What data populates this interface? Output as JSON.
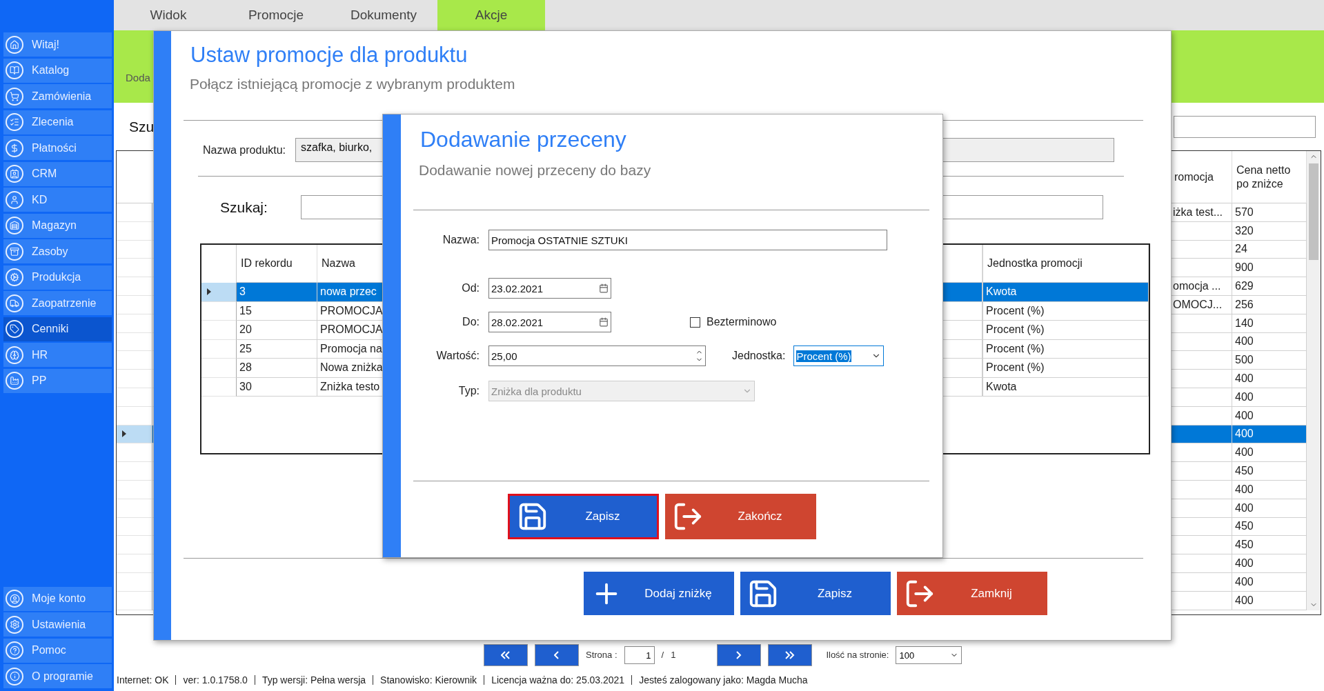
{
  "sidebar": {
    "items": [
      {
        "label": "Witaj!",
        "selected": false
      },
      {
        "label": "Katalog",
        "selected": false
      },
      {
        "label": "Zamówienia",
        "selected": false
      },
      {
        "label": "Zlecenia",
        "selected": false
      },
      {
        "label": "Płatności",
        "selected": false
      },
      {
        "label": "CRM",
        "selected": false
      },
      {
        "label": "KD",
        "selected": false
      },
      {
        "label": "Magazyn",
        "selected": false
      },
      {
        "label": "Zasoby",
        "selected": false
      },
      {
        "label": "Produkcja",
        "selected": false
      },
      {
        "label": "Zaopatrzenie",
        "selected": false
      },
      {
        "label": "Cenniki",
        "selected": true
      },
      {
        "label": "HR",
        "selected": false
      },
      {
        "label": "PP",
        "selected": false
      }
    ],
    "bottom_items": [
      {
        "label": "Moje konto"
      },
      {
        "label": "Ustawienia"
      },
      {
        "label": "Pomoc"
      },
      {
        "label": "O programie"
      }
    ]
  },
  "menu_tabs": [
    {
      "label": "Widok",
      "selected": false
    },
    {
      "label": "Promocje",
      "selected": false
    },
    {
      "label": "Dokumenty",
      "selected": false
    },
    {
      "label": "Akcje",
      "selected": true
    }
  ],
  "background": {
    "toolbar_label": "Doda",
    "search_label": "Szu",
    "table": {
      "columns": [
        "romocja",
        "Cena netto po zniżce"
      ],
      "rows": [
        {
          "column_1": "iżka test...",
          "price": "570",
          "selected": false
        },
        {
          "price": "320",
          "selected": false
        },
        {
          "price": "24",
          "selected": false
        },
        {
          "price": "900",
          "selected": false
        },
        {
          "column_1": "omocja ...",
          "price": "629",
          "selected": false
        },
        {
          "column_1": "OMOCJ...",
          "price": "256",
          "selected": false
        },
        {
          "price": "140",
          "selected": false
        },
        {
          "price": "400",
          "selected": false
        },
        {
          "price": "500",
          "selected": false
        },
        {
          "price": "400",
          "selected": false
        },
        {
          "price": "400",
          "selected": false
        },
        {
          "price": "400",
          "selected": false
        },
        {
          "price": "400",
          "selected": true
        },
        {
          "price": "400",
          "selected": false
        },
        {
          "price": "450",
          "selected": false
        },
        {
          "price": "400",
          "selected": false
        },
        {
          "price": "400",
          "selected": false
        },
        {
          "price": "450",
          "selected": false
        },
        {
          "price": "450",
          "selected": false
        },
        {
          "price": "400",
          "selected": false
        },
        {
          "price": "400",
          "selected": false
        },
        {
          "price": "400",
          "selected": false
        }
      ]
    },
    "pagination": {
      "page_label": "Strona :",
      "page": "1",
      "separator": "/",
      "total": "1",
      "per_page_label": "Ilość na stronie:",
      "per_page": "100"
    }
  },
  "promo_dialog": {
    "title": "Ustaw promocje dla produktu",
    "subtitle": "Połącz istniejącą promocje z wybranym produktem",
    "product_label": "Nazwa produktu:",
    "product_value": "szafka, biurko,",
    "search_label": "Szukaj:",
    "table": {
      "columns": [
        "ID rekordu",
        "Nazwa",
        "Jednostka promocji"
      ],
      "rows": [
        {
          "id": "3",
          "name": "nowa przec",
          "unit": "Kwota",
          "selected": true
        },
        {
          "id": "15",
          "name": "PROMOCJA",
          "unit": "Procent (%)",
          "selected": false
        },
        {
          "id": "20",
          "name": "PROMOCJA",
          "unit": "Procent (%)",
          "selected": false
        },
        {
          "id": "25",
          "name": "Promocja na",
          "unit": "Procent (%)",
          "selected": false
        },
        {
          "id": "28",
          "name": "Nowa zniżka",
          "unit": "Procent (%)",
          "selected": false
        },
        {
          "id": "30",
          "name": "Zniżka testo",
          "unit": "Kwota",
          "selected": false
        }
      ]
    },
    "buttons": [
      {
        "label": "Dodaj zniżkę",
        "kind": "add"
      },
      {
        "label": "Zapisz",
        "kind": "save"
      },
      {
        "label": "Zamknij",
        "kind": "exit"
      }
    ]
  },
  "discount_dialog": {
    "title": "Dodawanie przeceny",
    "subtitle": "Dodawanie nowej przeceny do bazy",
    "name": {
      "label": "Nazwa:",
      "value": "Promocja OSTATNIE SZTUKI"
    },
    "from": {
      "label": "Od:",
      "value": "23.02.2021"
    },
    "to": {
      "label": "Do:",
      "value": "28.02.2021"
    },
    "indefinite": {
      "label": "Bezterminowo",
      "checked": false
    },
    "amount": {
      "label": "Wartość:",
      "value": "25,00"
    },
    "unit": {
      "label": "Jednostka:",
      "value": "Procent (%)",
      "highlighted": true
    },
    "type": {
      "label": "Typ:",
      "value": "Zniżka dla produktu",
      "disabled": true
    },
    "buttons": [
      {
        "label": "Zapisz",
        "kind": "save",
        "focused": true
      },
      {
        "label": "Zakończ",
        "kind": "exit",
        "focused": false
      }
    ]
  },
  "status_bar": [
    "Internet: OK",
    "ver: 1.0.1758.0",
    "Typ wersji: Pełna wersja",
    "Stanowisko: Kierownik",
    "Licencja ważna do: 25.03.2021",
    "Jesteś zalogowany jako: Magda Mucha"
  ]
}
